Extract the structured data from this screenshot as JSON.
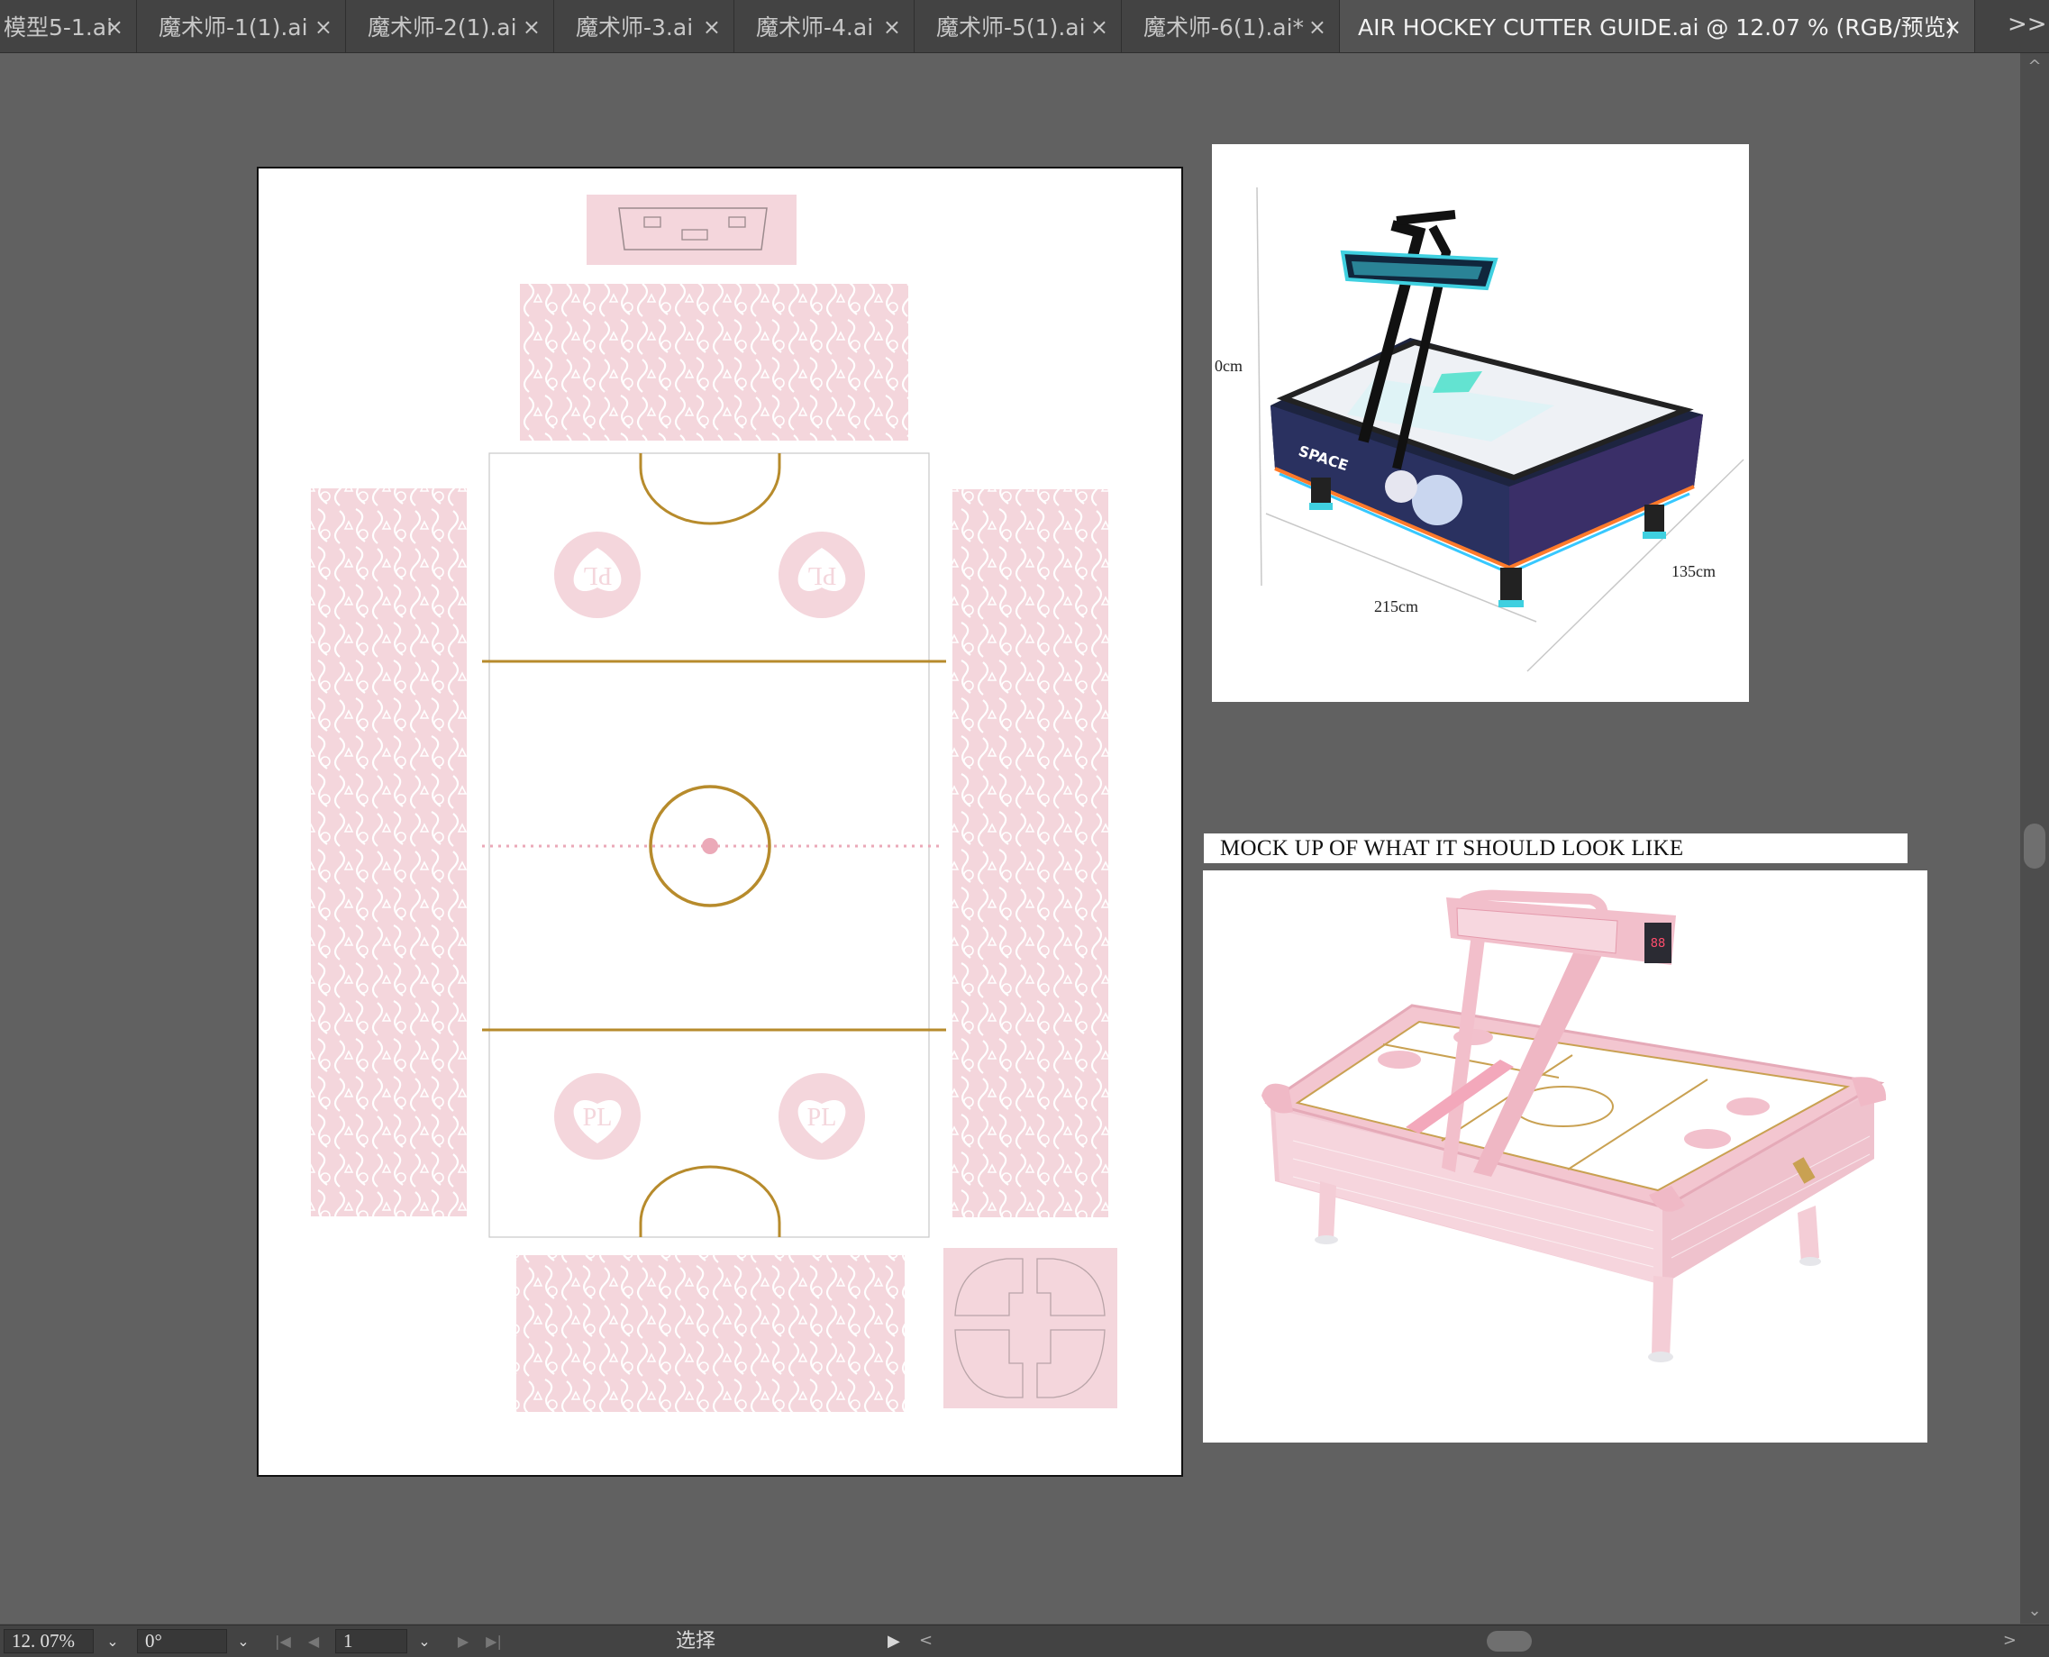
{
  "tabs": [
    {
      "label": "模型5-1.ai",
      "close": "×"
    },
    {
      "label": "魔术师-1(1).ai",
      "close": "×"
    },
    {
      "label": "魔术师-2(1).ai",
      "close": "×"
    },
    {
      "label": "魔术师-3.ai",
      "close": "×"
    },
    {
      "label": "魔术师-4.ai",
      "close": "×"
    },
    {
      "label": "魔术师-5(1).ai",
      "close": "×"
    },
    {
      "label": "魔术师-6(1).ai*",
      "close": "×"
    },
    {
      "label": "AIR HOCKEY CUTTER GUIDE.ai @ 12.07 % (RGB/预览)",
      "close": "×",
      "active": true
    }
  ],
  "tab_overflow": ">>",
  "colors": {
    "pink": "#f4d6dc",
    "pink_dark": "#e9b6c1",
    "gold": "#b78b2c",
    "pink_dot": "#eba9b8"
  },
  "artboard": {
    "logo_text": "PL"
  },
  "reference_image": {
    "height_label": "0cm",
    "width_label": "215cm",
    "depth_label": "135cm",
    "sign_text": "SPACE"
  },
  "mockup": {
    "caption": "MOCK UP OF WHAT IT SHOULD LOOK LIKE",
    "puck_text": "88"
  },
  "statusbar": {
    "zoom": "12. 07%",
    "rotation": "0°",
    "artboard_number": "1",
    "tool": "选择",
    "dropdown_icon": "⌄",
    "first_icon": "|◀",
    "prev_icon": "◀",
    "next_icon": "▶",
    "last_icon": "▶|",
    "play_icon": "▶",
    "left_arrow": "<",
    "right_arrow": ">"
  },
  "scroll": {
    "up": "^",
    "down": "⌄"
  }
}
